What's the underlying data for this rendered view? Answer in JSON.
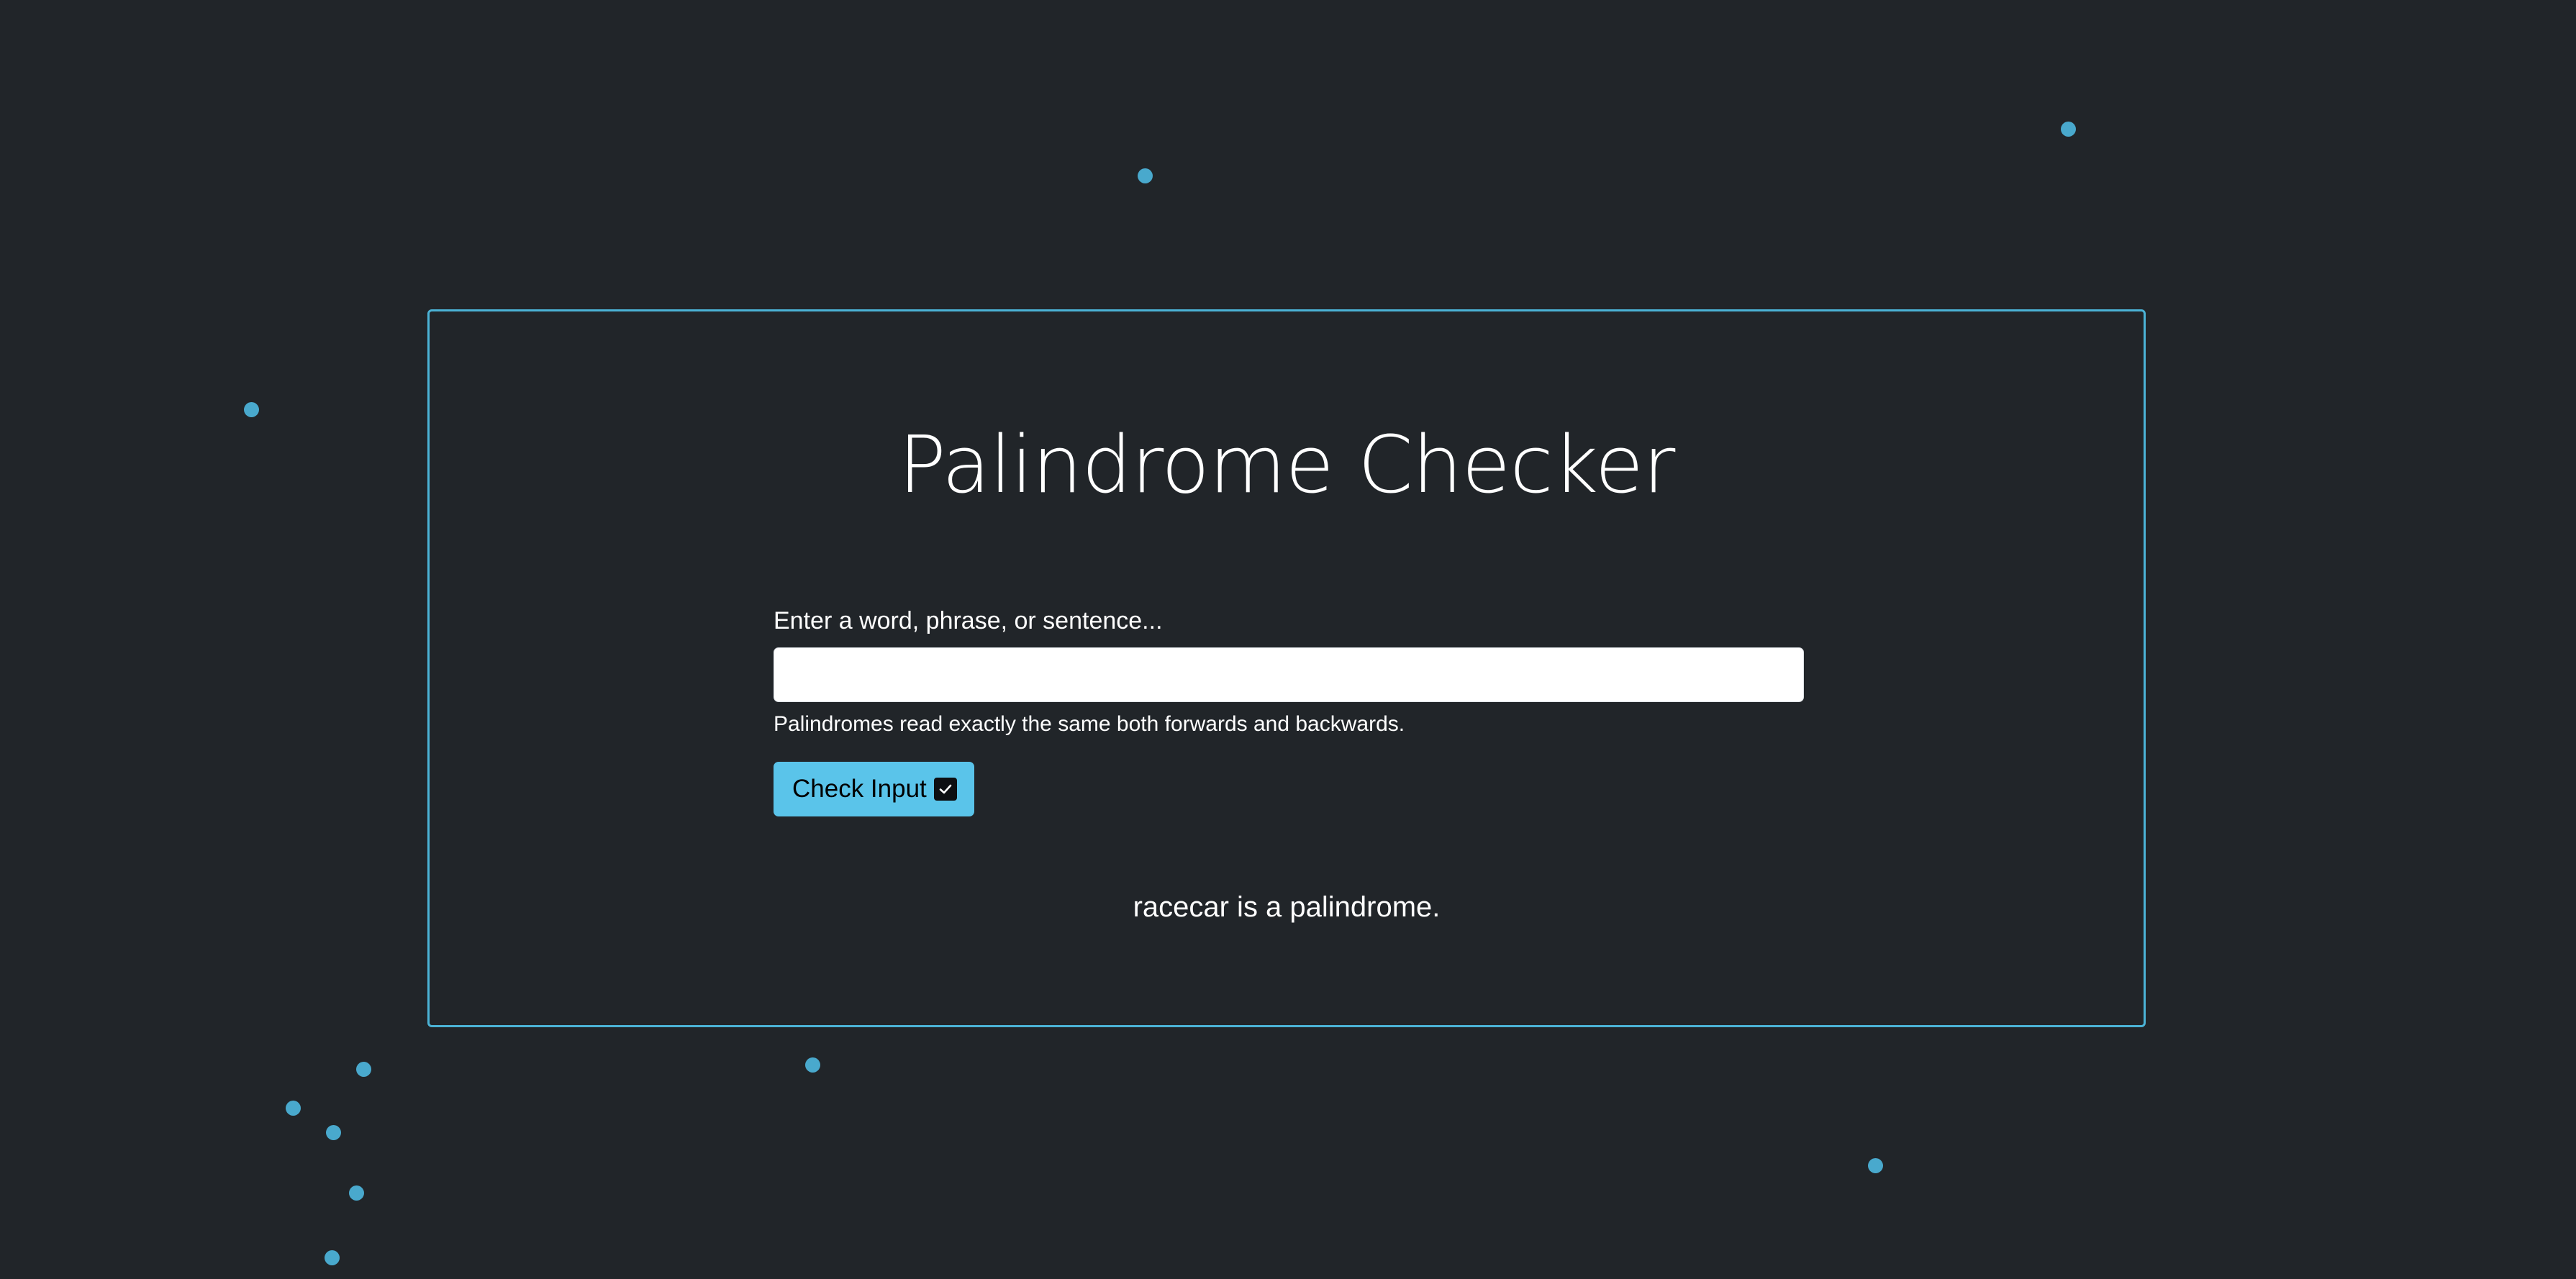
{
  "app": {
    "title": "Palindrome Checker"
  },
  "form": {
    "label": "Enter a word, phrase, or sentence...",
    "input_value": "",
    "input_placeholder": "",
    "help_text": "Palindromes read exactly the same both forwards and backwards.",
    "button_label": "Check Input",
    "button_icon": "check-square-icon"
  },
  "result": {
    "text": "racecar is a palindrome."
  },
  "colors": {
    "background": "#212529",
    "accent": "#4bb3d6",
    "button": "#5ac4ea",
    "decorative_dots": "#49a9cd"
  }
}
